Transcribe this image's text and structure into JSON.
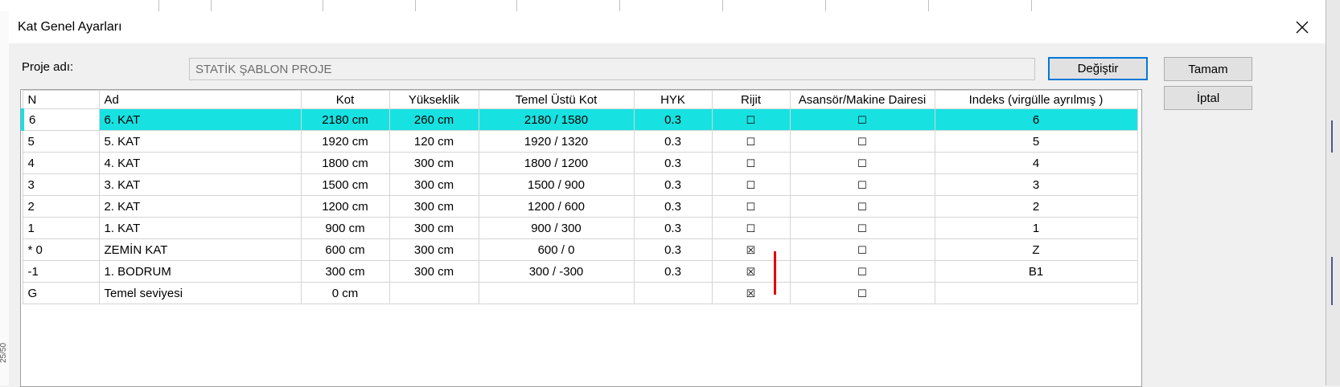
{
  "dialog": {
    "title": "Kat Genel Ayarları",
    "project_label": "Proje adı:",
    "project_value": "STATİK ŞABLON PROJE",
    "change_button": "Değiştir",
    "ok_button": "Tamam",
    "cancel_button": "İptal"
  },
  "background": {
    "side_label": "25/50"
  },
  "grid": {
    "columns": [
      "N",
      "Ad",
      "Kot",
      "Yükseklik",
      "Temel Üstü Kot",
      "HYK",
      "Rijit",
      "Asansör/Makine Dairesi",
      "Indeks (virgülle ayrılmış )"
    ],
    "rows": [
      {
        "n": "6",
        "ad": "6. KAT",
        "kot": "2180 cm",
        "yuk": "260 cm",
        "temel": "2180 / 1580",
        "hyk": "0.3",
        "rijit": "☐",
        "asan": "☐",
        "idx": "6"
      },
      {
        "n": "5",
        "ad": "5. KAT",
        "kot": "1920 cm",
        "yuk": "120 cm",
        "temel": "1920 / 1320",
        "hyk": "0.3",
        "rijit": "☐",
        "asan": "☐",
        "idx": "5"
      },
      {
        "n": "4",
        "ad": "4. KAT",
        "kot": "1800 cm",
        "yuk": "300 cm",
        "temel": "1800 / 1200",
        "hyk": "0.3",
        "rijit": "☐",
        "asan": "☐",
        "idx": "4"
      },
      {
        "n": "3",
        "ad": "3. KAT",
        "kot": "1500 cm",
        "yuk": "300 cm",
        "temel": "1500 / 900",
        "hyk": "0.3",
        "rijit": "☐",
        "asan": "☐",
        "idx": "3"
      },
      {
        "n": "2",
        "ad": "2. KAT",
        "kot": "1200 cm",
        "yuk": "300 cm",
        "temel": "1200 / 600",
        "hyk": "0.3",
        "rijit": "☐",
        "asan": "☐",
        "idx": "2"
      },
      {
        "n": "1",
        "ad": "1. KAT",
        "kot": "900 cm",
        "yuk": "300 cm",
        "temel": "900 / 300",
        "hyk": "0.3",
        "rijit": "☐",
        "asan": "☐",
        "idx": "1"
      },
      {
        "n": "* 0",
        "ad": "ZEMİN KAT",
        "kot": "600 cm",
        "yuk": "300 cm",
        "temel": "600 / 0",
        "hyk": "0.3",
        "rijit": "☒",
        "asan": "☐",
        "idx": "Z"
      },
      {
        "n": "-1",
        "ad": "1. BODRUM",
        "kot": "300 cm",
        "yuk": "300 cm",
        "temel": "300 / -300",
        "hyk": "0.3",
        "rijit": "☒",
        "asan": "☐",
        "idx": "B1"
      },
      {
        "n": "G",
        "ad": "Temel seviyesi",
        "kot": "0 cm",
        "yuk": "",
        "temel": "",
        "hyk": "",
        "rijit": "☒",
        "asan": "☐",
        "idx": ""
      }
    ]
  }
}
